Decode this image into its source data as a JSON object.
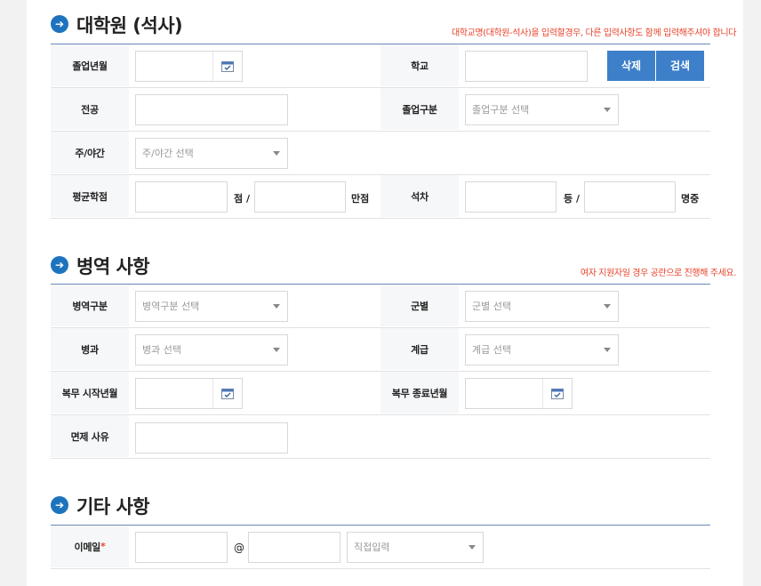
{
  "sections": {
    "grad": {
      "icon": "arrow-right-circle-icon",
      "title": "대학원 (석사)",
      "notice": "대학교명(대학원-석사)을 입력할경우, 다른 입력사항도 함께 입력해주셔야 합니다",
      "labels": {
        "grad_date": "졸업년월",
        "school": "학교",
        "major": "전공",
        "grad_type": "졸업구분",
        "day_night": "주/야간",
        "gpa": "평균학점",
        "rank": "석차"
      },
      "selects": {
        "grad_type": "졸업구분 선택",
        "day_night": "주/야간 선택"
      },
      "units": {
        "points": "점 /",
        "full_points": "만점",
        "place": "등 /",
        "of_people": "명중"
      },
      "buttons": {
        "delete": "삭제",
        "search": "검색"
      }
    },
    "military": {
      "icon": "arrow-right-circle-icon",
      "title": "병역 사항",
      "notice": "여자 지원자일 경우 공란으로 진행해 주세요.",
      "labels": {
        "mil_type": "병역구분",
        "branch": "군별",
        "specialty": "병과",
        "rank": "계급",
        "start": "복무 시작년월",
        "end": "복무 종료년월",
        "exempt": "면제 사유"
      },
      "selects": {
        "mil_type": "병역구분 선택",
        "branch": "군별 선택",
        "specialty": "병과 선택",
        "rank": "계급 선택"
      }
    },
    "etc": {
      "icon": "arrow-right-circle-icon",
      "title": "기타 사항",
      "labels": {
        "email": "이메일",
        "required_mark": "*"
      },
      "at_sign": "@",
      "selects": {
        "domain": "직접입력"
      }
    }
  },
  "colors": {
    "accent": "#1e73be",
    "button": "#3d7fc8",
    "notice": "#e8432b",
    "label_bg": "#f6f7f9"
  }
}
